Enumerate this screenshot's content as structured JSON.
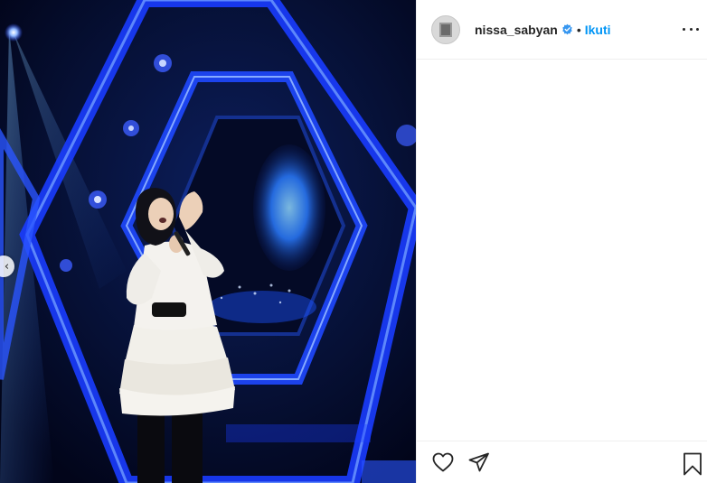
{
  "post": {
    "author": {
      "username": "nissa_sabyan",
      "verified": true
    },
    "follow_label": "Ikuti",
    "separator": "•",
    "image": {
      "description_icon": "photo",
      "has_previous": true
    }
  },
  "icons": {
    "more": "more-horizontal-icon",
    "like": "heart-icon",
    "share": "paper-plane-icon",
    "save": "bookmark-icon",
    "prev": "chevron-left-icon",
    "verified": "verified-badge-icon"
  },
  "colors": {
    "accent": "#0095f6",
    "text": "#262626",
    "border": "#efefef"
  }
}
